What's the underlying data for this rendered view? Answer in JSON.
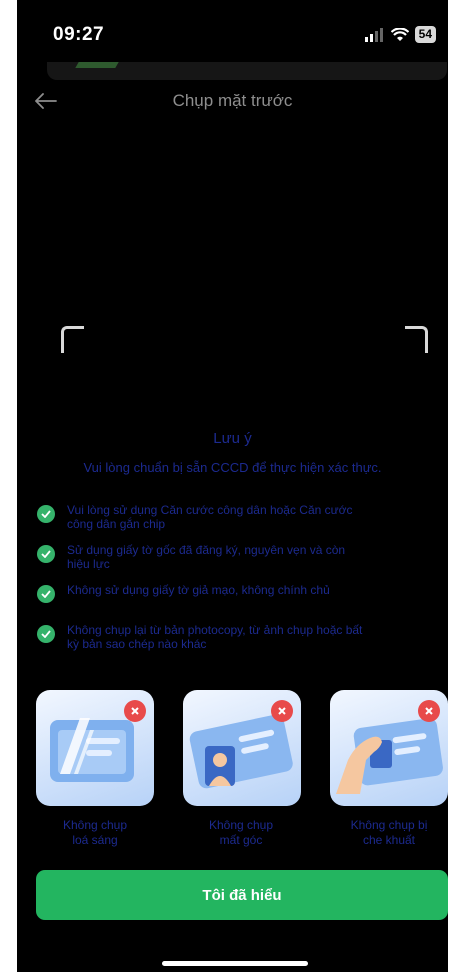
{
  "status_bar": {
    "time": "09:27",
    "battery": "54"
  },
  "header": {
    "title": "Chụp mặt trước"
  },
  "note": {
    "title": "Lưu ý",
    "subtitle": "Vui lòng chuẩn bị sẵn CCCD để thực hiện xác thực.",
    "items": [
      {
        "line1": "Vui lòng sử dụng Căn cước công dân hoặc Căn cước",
        "line2": "công dân gắn chip"
      },
      {
        "line1": "Sử dụng giấy tờ gốc đã đăng ký, nguyên vẹn và còn",
        "line2": "hiệu lực"
      },
      {
        "line1": "Không sử dụng giấy tờ giả mạo, không chính chủ",
        "line2": ""
      },
      {
        "line1": "Không chụp lại từ bản photocopy, từ ảnh chụp hoặc bất",
        "line2": "kỳ bản sao chép nào khác"
      }
    ]
  },
  "cards": [
    {
      "line1": "Không chụp",
      "line2": "loá sáng",
      "icon": "glare-card-icon"
    },
    {
      "line1": "Không chụp",
      "line2": "mất góc",
      "icon": "cut-corner-card-icon"
    },
    {
      "line1": "Không chụp bị",
      "line2": "che khuất",
      "icon": "covered-card-icon"
    }
  ],
  "cta": {
    "label": "Tôi đã hiểu"
  },
  "colors": {
    "background": "#000000",
    "accent_green": "#23b560",
    "note_text": "#1c2a8f",
    "error_badge": "#e84a4a"
  }
}
